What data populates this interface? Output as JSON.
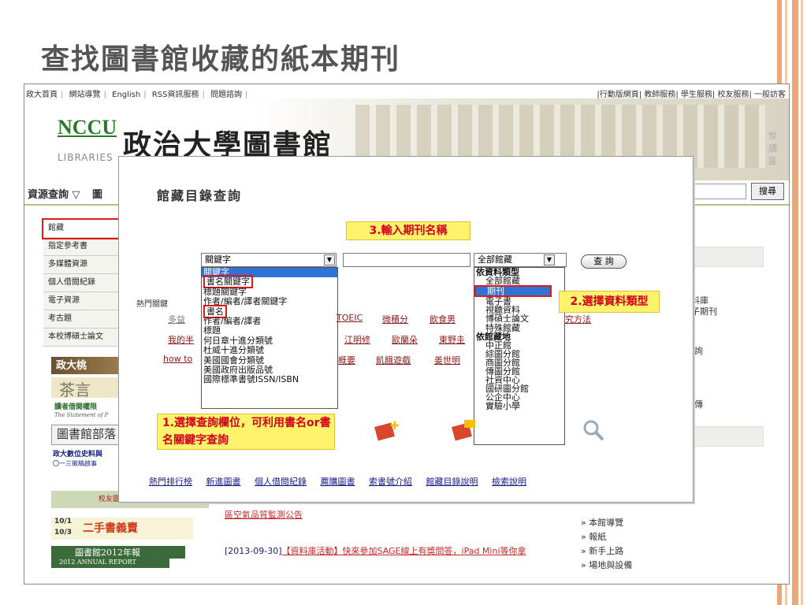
{
  "slide": {
    "title": "查找圖書館收藏的紙本期刊"
  },
  "site": {
    "top_links_left": [
      "政大首頁",
      "網站導覽",
      "English",
      "RSS資訊服務",
      "問題諮詢"
    ],
    "top_links_right": [
      "行動版網頁",
      "教師服務",
      "學生服務",
      "校友服務",
      "一般訪客"
    ],
    "logo_abbr": "NCCU",
    "logo_en": "LIBRARIES",
    "logo_cn": "政治大學圖書館",
    "side_slogan": "悅讀區",
    "nav_title": "資源查詢 ▽",
    "nav_partial": "圖",
    "search_button": "搜尋"
  },
  "sidebar": {
    "items": [
      "館藏",
      "指定參考書",
      "多媒體資源",
      "個人借閱紀錄",
      "電子資源",
      "考古題",
      "本校博碩士論文"
    ]
  },
  "banners": [
    "政大桃",
    "茶言",
    "讀者借閱權限",
    "The Statement of P",
    "圖書館部落",
    "政大數位史料與",
    "〇一三徵稿啟事",
    "校友圖",
    "二手書義賣",
    "10/1",
    "10/3",
    "圖書館2012年報",
    "2012 ANNUAL REPORT"
  ],
  "news": [
    {
      "date": "[2013-09-30]",
      "text": "【資料庫活動】快來參加SAGE線上有獎問答，iPad Mini等你拿"
    },
    {
      "date": "",
      "text": "區空氣品質監測公告"
    }
  ],
  "right_list_top": [
    "料庫",
    "子期刊",
    "詢",
    "傳"
  ],
  "right_list": [
    "本館導覽",
    "報紙",
    "新手上路",
    "場地與設備"
  ],
  "modal": {
    "title": "館藏目錄查詢",
    "field_select_value": "關鍵字",
    "field_options": [
      "關鍵字",
      "書名關鍵字",
      "標題關鍵字",
      "作者/編者/譯者關鍵字",
      "書名",
      "作者/編者/譯者",
      "標題",
      "何日章十進分類號",
      "杜威十進分類號",
      "美國國會分類號",
      "美國政府出版品號",
      "國際標準書號ISSN/ISBN"
    ],
    "library_select_value": "全部館藏",
    "library_options": [
      {
        "label": "依資料類型",
        "type": "group"
      },
      {
        "label": "全部館藏",
        "type": "item"
      },
      {
        "label": "期刊",
        "type": "selected"
      },
      {
        "label": "電子書",
        "type": "item"
      },
      {
        "label": "視聽資料",
        "type": "item"
      },
      {
        "label": "博碩士論文",
        "type": "item"
      },
      {
        "label": "特殊館藏",
        "type": "item"
      },
      {
        "label": "依館藏地",
        "type": "group"
      },
      {
        "label": "中正館",
        "type": "item"
      },
      {
        "label": "綜圖分館",
        "type": "item"
      },
      {
        "label": "商圖分館",
        "type": "item"
      },
      {
        "label": "傳圖分館",
        "type": "item"
      },
      {
        "label": "社資中心",
        "type": "item"
      },
      {
        "label": "國研圖分館",
        "type": "item"
      },
      {
        "label": "公企中心",
        "type": "item"
      },
      {
        "label": "實驗小學",
        "type": "item"
      }
    ],
    "query_button": "查 詢",
    "hot_label": "熱門關鍵",
    "hot_keywords_row1": [
      "多益",
      "TOEIC",
      "微積分",
      "飲食男",
      "究方法"
    ],
    "hot_keywords_row2": [
      "我的半",
      "江明修",
      "歐蘭朵",
      "東野圭"
    ],
    "hot_keywords_row3": [
      "how to",
      "概要",
      "飢餓遊戲",
      "姜世明"
    ],
    "bottom_links": [
      "熱門排行榜",
      "新進圖書",
      "個人借閱紀錄",
      "薦購圖書",
      "索書號介紹",
      "館藏目錄說明",
      "檢索說明"
    ]
  },
  "callouts": {
    "step1": "1.選擇查詢欄位，可利用書名or書名關鍵字查詢",
    "step2": "2.選擇資料類型",
    "step3": "3.輸入期刊名稱"
  }
}
